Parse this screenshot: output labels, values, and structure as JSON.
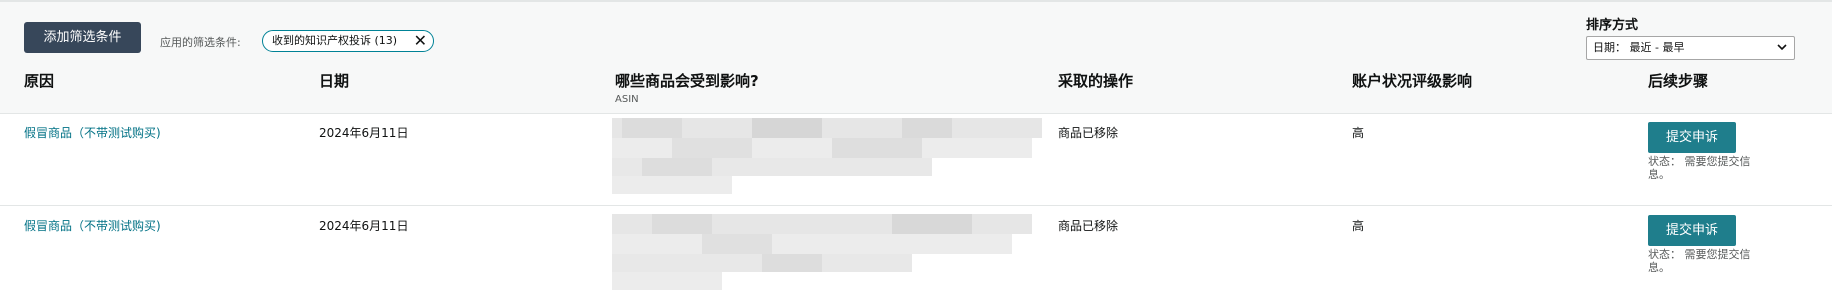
{
  "toolbar": {
    "add_filter_label": "添加筛选条件",
    "applied_label": "应用的筛选条件:",
    "filter_chip": "收到的知识产权投诉 (13)"
  },
  "sort": {
    "label": "排序方式",
    "selected": "日期： 最近 - 最早"
  },
  "table": {
    "columns": [
      "原因",
      "日期",
      "哪些商品会受到影响?",
      "采取的操作",
      "账户状况评级影响",
      "后续步骤"
    ],
    "asin_label": "ASIN",
    "rows": [
      {
        "reason": "假冒商品（不带测试购买)",
        "date": "2024年6月11日",
        "action": "商品已移除",
        "impact": "高",
        "next_button": "提交申诉",
        "status": "状态： 需要您提交信息。"
      },
      {
        "reason": "假冒商品（不带测试购买)",
        "date": "2024年6月11日",
        "action": "商品已移除",
        "impact": "高",
        "next_button": "提交申诉",
        "status": "状态： 需要您提交信息。"
      }
    ]
  },
  "colors": {
    "accent": "#007185",
    "button_dark": "#37475a",
    "button_teal": "#1f7e8c"
  }
}
